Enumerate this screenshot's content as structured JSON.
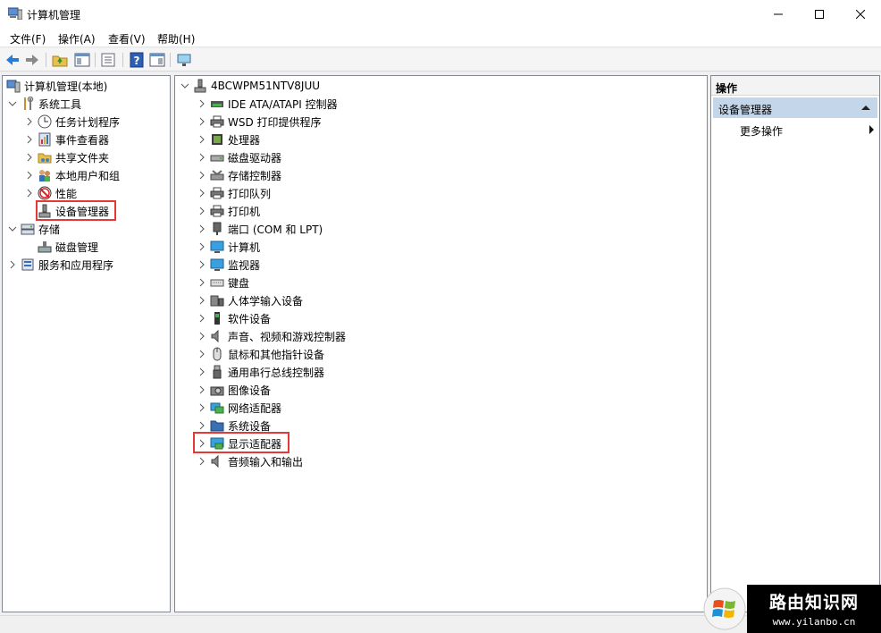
{
  "window": {
    "title": "计算机管理"
  },
  "menu": [
    "文件(F)",
    "操作(A)",
    "查看(V)",
    "帮助(H)"
  ],
  "left_tree": {
    "root": "计算机管理(本地)",
    "system_tools": "系统工具",
    "system_children": [
      "任务计划程序",
      "事件查看器",
      "共享文件夹",
      "本地用户和组",
      "性能",
      "设备管理器"
    ],
    "storage": "存储",
    "storage_children": [
      "磁盘管理"
    ],
    "services": "服务和应用程序"
  },
  "device_tree": {
    "computer_name": "4BCWPM51NTV8JUU",
    "categories": [
      "IDE ATA/ATAPI 控制器",
      "WSD 打印提供程序",
      "处理器",
      "磁盘驱动器",
      "存储控制器",
      "打印队列",
      "打印机",
      "端口 (COM 和 LPT)",
      "计算机",
      "监视器",
      "键盘",
      "人体学输入设备",
      "软件设备",
      "声音、视频和游戏控制器",
      "鼠标和其他指针设备",
      "通用串行总线控制器",
      "图像设备",
      "网络适配器",
      "系统设备",
      "显示适配器",
      "音频输入和输出"
    ]
  },
  "actions": {
    "header": "操作",
    "section": "设备管理器",
    "more": "更多操作"
  },
  "watermark": {
    "name": "路由知识网",
    "url": "www.yilanbo.cn"
  },
  "colors": {
    "highlight_border": "#e53935",
    "action_section_bg": "#c4d6ea"
  }
}
